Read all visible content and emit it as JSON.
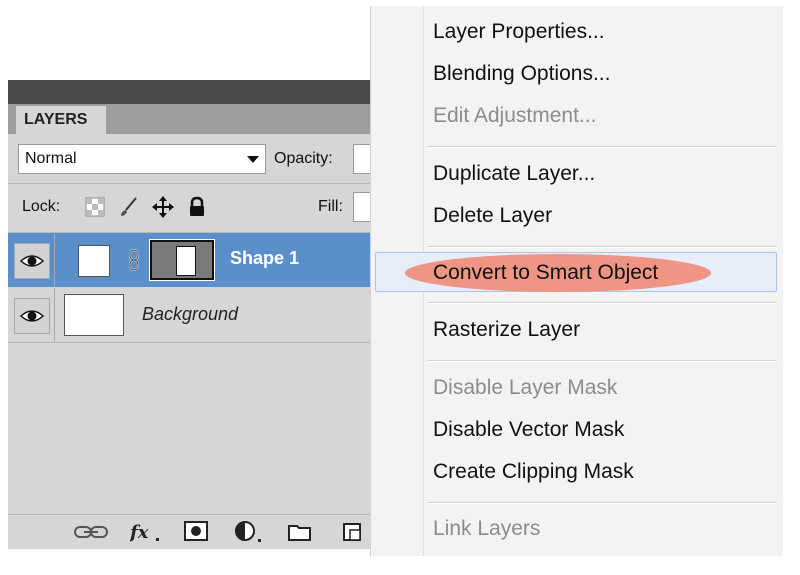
{
  "layers_panel": {
    "tab_label": "LAYERS",
    "blend_mode": "Normal",
    "opacity_label": "Opacity:",
    "lock_label": "Lock:",
    "fill_label": "Fill:",
    "layers": [
      {
        "name": "Shape 1",
        "selected": true
      },
      {
        "name": "Background",
        "selected": false
      }
    ],
    "footer_icons": [
      "link-icon",
      "fx-icon",
      "add-mask-icon",
      "adjustment-layer-icon",
      "new-group-icon",
      "new-layer-icon"
    ]
  },
  "context_menu": {
    "items": [
      {
        "label": "Layer Properties...",
        "enabled": true
      },
      {
        "label": "Blending Options...",
        "enabled": true
      },
      {
        "label": "Edit Adjustment...",
        "enabled": false
      },
      {
        "label": "Duplicate Layer...",
        "enabled": true
      },
      {
        "label": "Delete Layer",
        "enabled": true
      },
      {
        "label": "Convert to Smart Object",
        "enabled": true,
        "highlighted": true
      },
      {
        "label": "Rasterize Layer",
        "enabled": true
      },
      {
        "label": "Disable Layer Mask",
        "enabled": false
      },
      {
        "label": "Disable Vector Mask",
        "enabled": true
      },
      {
        "label": "Create Clipping Mask",
        "enabled": true
      },
      {
        "label": "Link Layers",
        "enabled": false
      }
    ]
  },
  "colors": {
    "selection_blue": "#5a8fcb",
    "highlight_oval": "#ee8f7d",
    "panel_bg": "#d6d6d6",
    "menu_bg": "#f3f3f3"
  }
}
